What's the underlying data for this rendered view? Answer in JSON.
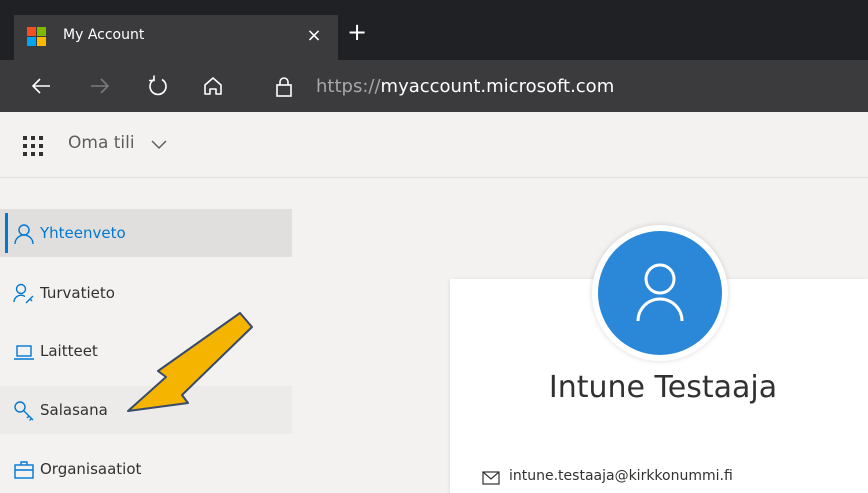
{
  "browser": {
    "tab_title": "My Account",
    "close_glyph": "×",
    "new_tab_glyph": "+",
    "url_scheme": "https://",
    "url_host": "myaccount.microsoft.com",
    "icons": [
      "back-icon",
      "forward-icon",
      "refresh-icon",
      "home-icon",
      "lock-icon"
    ]
  },
  "app": {
    "title": "Oma tili",
    "chevron_icon": "chevron-down-icon",
    "waffle_icon": "app-launcher-icon"
  },
  "sidebar": {
    "items": [
      {
        "label": "Yhteenveto",
        "icon": "person-icon",
        "active": true
      },
      {
        "label": "Turvatieto",
        "icon": "person-key-icon",
        "active": false
      },
      {
        "label": "Laitteet",
        "icon": "laptop-icon",
        "active": false
      },
      {
        "label": "Salasana",
        "icon": "key-icon",
        "active": false
      },
      {
        "label": "Organisaatiot",
        "icon": "briefcase-icon",
        "active": false
      }
    ]
  },
  "profile": {
    "display_name": "Intune Testaaja",
    "email": "intune.testaaja@kirkkonummi.fi"
  },
  "colors": {
    "accent": "#0078d4",
    "avatar": "#2b88d8",
    "arrow_fill": "#f5b400",
    "arrow_outline": "#3a4a6b",
    "browser_dark": "#202124",
    "browser_tab": "#3b3b3d"
  }
}
